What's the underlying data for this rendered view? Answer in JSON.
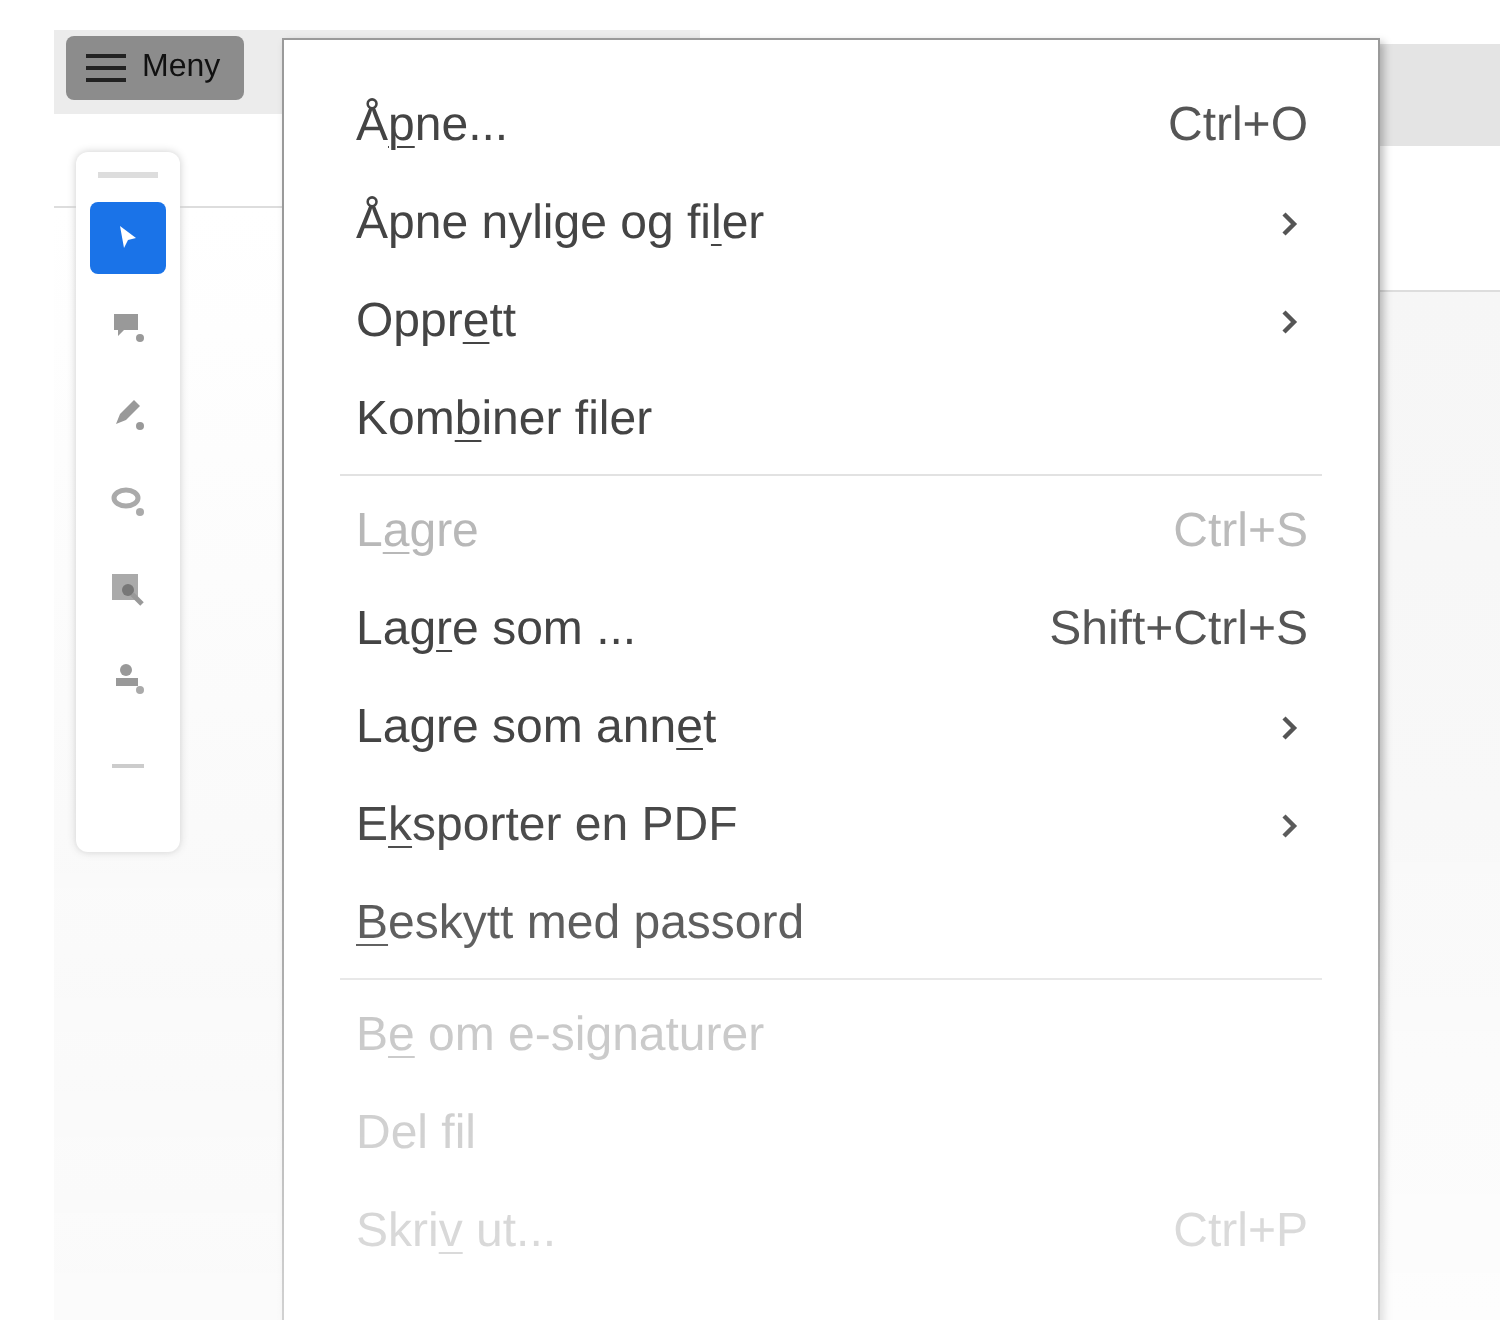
{
  "menu_button": {
    "label": "Meny"
  },
  "toolbar": {
    "tools": [
      {
        "kind": "select",
        "selected": true
      },
      {
        "kind": "comment",
        "selected": false
      },
      {
        "kind": "pen",
        "selected": false
      },
      {
        "kind": "lasso",
        "selected": false
      },
      {
        "kind": "image-search",
        "selected": false
      },
      {
        "kind": "stamp",
        "selected": false
      },
      {
        "kind": "more",
        "selected": false
      }
    ]
  },
  "menu": {
    "groups": [
      {
        "items": [
          {
            "label_start": "Å",
            "access_key": "p",
            "label_end": "ne...",
            "shortcut": "Ctrl+O",
            "submenu": false,
            "disabled": false
          },
          {
            "label_start": "Åpne nylige og fi",
            "access_key": "l",
            "label_end": "er",
            "submenu": true,
            "disabled": false
          },
          {
            "label_start": "Oppr",
            "access_key": "e",
            "label_end": "tt",
            "submenu": true,
            "disabled": false
          },
          {
            "label_start": "Kom",
            "access_key": "b",
            "label_end": "iner filer",
            "submenu": false,
            "disabled": false
          }
        ]
      },
      {
        "items": [
          {
            "label_start": "L",
            "access_key": "a",
            "label_end": "gre",
            "shortcut": "Ctrl+S",
            "submenu": false,
            "disabled": true
          },
          {
            "label_start": "Lag",
            "access_key": "r",
            "label_end": "e som ...",
            "shortcut": "Shift+Ctrl+S",
            "submenu": false,
            "disabled": false
          },
          {
            "label_start": "Lagre som ann",
            "access_key": "e",
            "label_end": "t",
            "submenu": true,
            "disabled": false
          },
          {
            "label_start": "E",
            "access_key": "k",
            "label_end": "sporter en PDF",
            "submenu": true,
            "disabled": false
          },
          {
            "access_key": "B",
            "label_end": "eskytt med passord",
            "submenu": false,
            "disabled": false
          }
        ]
      },
      {
        "items": [
          {
            "label_start": "B",
            "access_key": "e",
            "label_end": " om e-signaturer",
            "submenu": false,
            "disabled": true
          },
          {
            "label_start": "Del fil",
            "submenu": false,
            "disabled": true
          },
          {
            "label_start": "Skri",
            "access_key": "v",
            "label_end": " ut...",
            "shortcut": "Ctrl+P",
            "submenu": false,
            "disabled": true
          }
        ]
      }
    ]
  }
}
